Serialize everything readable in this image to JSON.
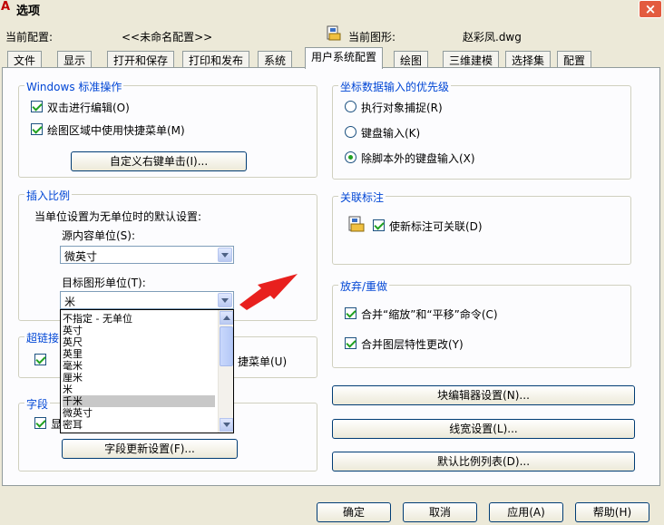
{
  "window": {
    "title": "选项",
    "close_label": "×"
  },
  "header": {
    "profile_label": "当前配置:",
    "profile_value": "<<未命名配置>>",
    "drawing_label": "当前图形:",
    "drawing_value": "赵彩凤.dwg"
  },
  "tabs": [
    {
      "label": "文件"
    },
    {
      "label": "显示"
    },
    {
      "label": "打开和保存"
    },
    {
      "label": "打印和发布"
    },
    {
      "label": "系统"
    },
    {
      "label": "用户系统配置"
    },
    {
      "label": "绘图"
    },
    {
      "label": "三维建模"
    },
    {
      "label": "选择集"
    },
    {
      "label": "配置"
    }
  ],
  "windows_ops": {
    "title": "Windows 标准操作",
    "dblclick": "双击进行编辑(O)",
    "shortcut_menu": "绘图区域中使用快捷菜单(M)",
    "custom_button": "自定义右键单击(I)..."
  },
  "insert_scale": {
    "title": "插入比例",
    "desc": "当单位设置为无单位时的默认设置:",
    "source_label": "源内容单位(S):",
    "source_value": "微英寸",
    "target_label": "目标图形单位(T):",
    "target_value": "米",
    "options": [
      "不指定 - 无单位",
      "英寸",
      "英尺",
      "英里",
      "毫米",
      "厘米",
      "米",
      "千米",
      "微英寸",
      "密耳"
    ]
  },
  "hyperlink": {
    "title": "超链接",
    "item_right": "捷菜单(U)"
  },
  "fields": {
    "title": "字段",
    "item": "显",
    "update_button": "字段更新设置(F)..."
  },
  "coord_priority": {
    "title": "坐标数据输入的优先级",
    "opt1": "执行对象捕捉(R)",
    "opt2": "键盘输入(K)",
    "opt3": "除脚本外的键盘输入(X)"
  },
  "assoc_dim": {
    "title": "关联标注",
    "item": "使新标注可关联(D)"
  },
  "undo_redo": {
    "title": "放弃/重做",
    "item1": "合并“缩放”和“平移”命令(C)",
    "item2": "合并图层特性更改(Y)"
  },
  "right_buttons": {
    "block_editor": "块编辑器设置(N)...",
    "lineweight": "线宽设置(L)...",
    "scale_list": "默认比例列表(D)..."
  },
  "footer": {
    "ok": "确定",
    "cancel": "取消",
    "apply": "应用(A)",
    "help": "帮助(H)"
  }
}
